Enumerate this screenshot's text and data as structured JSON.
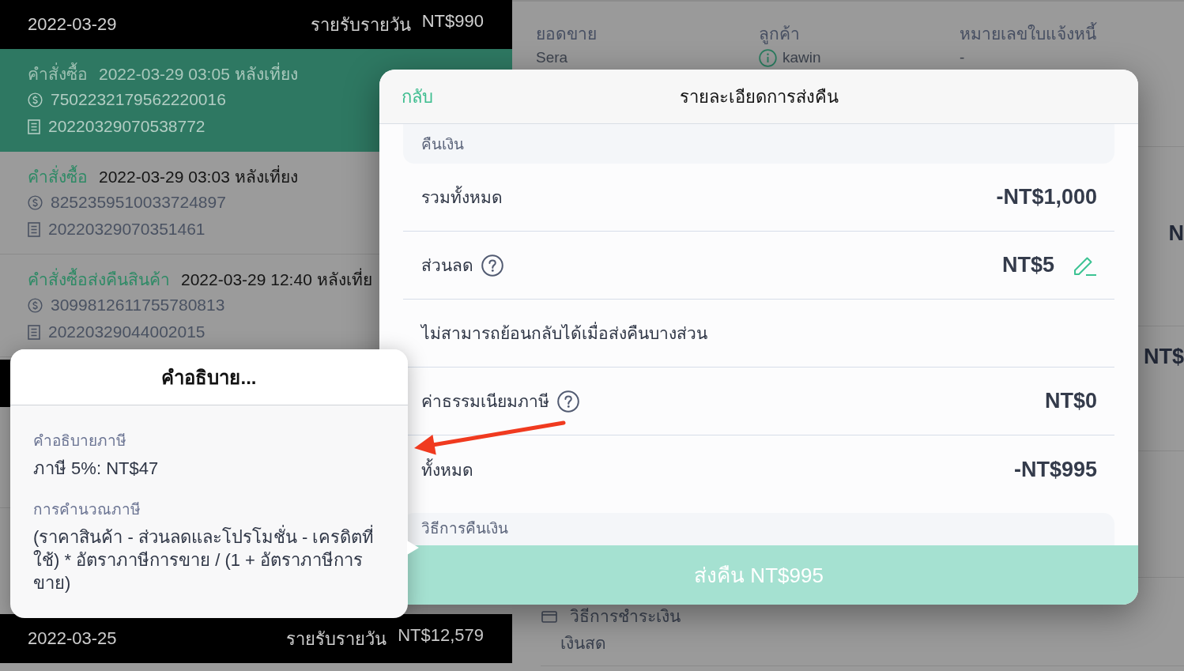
{
  "day_list": {
    "groups": [
      {
        "date": "2022-03-29",
        "income_label": "รายรับรายวัน",
        "income": "NT$990",
        "orders": [
          {
            "type": "คำสั่งซื้อ",
            "datetime": "2022-03-29 03:05 หลังเที่ยง",
            "payment_id": "7502232179562220016",
            "receipt_no": "20220329070538772",
            "selected": true
          },
          {
            "type": "คำสั่งซื้อ",
            "datetime": "2022-03-29 03:03 หลังเที่ยง",
            "payment_id": "8252359510033724897",
            "receipt_no": "20220329070351461",
            "selected": false
          },
          {
            "type": "คำสั่งซื้อส่งคืนสินค้า",
            "datetime": "2022-03-29 12:40 หลังเที่ย",
            "payment_id": "3099812611755780813",
            "receipt_no": "20220329044002015",
            "selected": false
          }
        ]
      },
      {
        "date": "2022-03-25",
        "income_label": "รายรับรายวัน",
        "income": "NT$12,579"
      }
    ]
  },
  "order_detail": {
    "fields": [
      {
        "label": "ยอดขาย",
        "value": "Sera",
        "kind": "text"
      },
      {
        "label": "ลูกค้า",
        "value": "kawin",
        "kind": "info"
      },
      {
        "label": "หมายเลขใบแจ้งหนี้",
        "value": "-",
        "kind": "text"
      }
    ],
    "amounts": [
      "N",
      "NT$"
    ],
    "payment": {
      "label": "วิธีการชำระเงิน",
      "value": "เงินสด"
    }
  },
  "return_dialog": {
    "back": "กลับ",
    "title": "รายละเอียดการส่งคืน",
    "refund_section": "คืนเงิน",
    "rows": [
      {
        "kind": "amount",
        "label": "รวมทั้งหมด",
        "value": "-NT$1,000"
      },
      {
        "kind": "editable",
        "label": "ส่วนลด",
        "value": "NT$5"
      },
      {
        "kind": "note",
        "label": "ไม่สามารถย้อนกลับได้เมื่อส่งคืนบางส่วน"
      },
      {
        "kind": "info",
        "label": "ค่าธรรมเนียมภาษี",
        "value": "NT$0"
      },
      {
        "kind": "amount",
        "label": "ทั้งหมด",
        "value": "-NT$995"
      }
    ],
    "method_section": "วิธีการคืนเงิน",
    "submit": "ส่งคืน NT$995"
  },
  "tax_popover": {
    "title": "คำอธิบาย...",
    "sections": [
      {
        "heading": "คำอธิบายภาษี",
        "text": "ภาษี 5%: NT$47"
      },
      {
        "heading": "การคำนวณภาษี",
        "text": "(ราคาสินค้า - ส่วนลดและโปรโมชั่น - เครดิตที่ใช้) * อัตราภาษีการขาย / (1 + อัตราภาษีการขาย)"
      }
    ]
  }
}
